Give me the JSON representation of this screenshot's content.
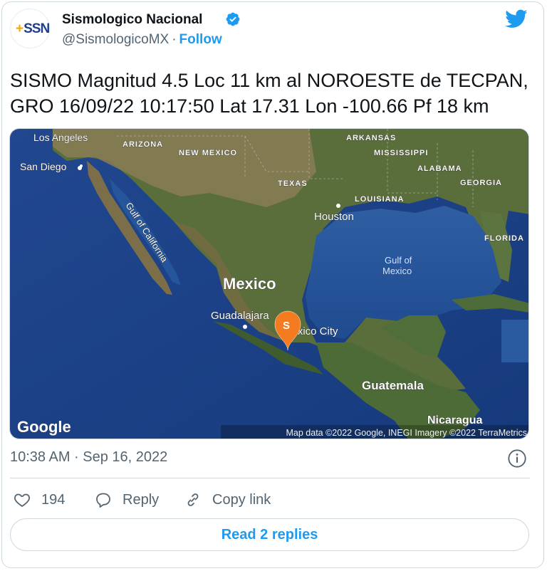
{
  "account": {
    "avatar_text": "SSN",
    "display_name": "Sismologico Nacional",
    "handle": "@SismologicoMX",
    "separator": "·",
    "follow_label": "Follow"
  },
  "tweet": {
    "text": "SISMO Magnitud 4.5 Loc  11 km al NOROESTE de TECPAN,\nGRO 16/09/22 10:17:50 Lat 17.31 Lon -100.66 Pf 18 km",
    "timestamp": "10:38 AM · Sep 16, 2022"
  },
  "map": {
    "labels": {
      "los_angeles": "Los Angeles",
      "arizona": "ARIZONA",
      "new_mexico": "NEW MEXICO",
      "arkansas": "ARKANSAS",
      "mississippi": "MISSISSIPPI",
      "alabama": "ALABAMA",
      "georgia": "GEORGIA",
      "san_diego": "San Diego",
      "texas": "TEXAS",
      "louisiana": "LOUISIANA",
      "houston": "Houston",
      "florida": "FLORIDA",
      "gulf_of_california": "Gulf of California",
      "gulf_of_mexico_1": "Gulf of",
      "gulf_of_mexico_2": "Mexico",
      "mexico": "Mexico",
      "guadalajara": "Guadalajara",
      "mexico_city": "Mexico City",
      "guatemala": "Guatemala",
      "nicaragua": "Nicaragua"
    },
    "marker_letter": "S",
    "logo": "Google",
    "attribution": "Map data ©2022 Google, INEGI Imagery ©2022 TerraMetrics",
    "colors": {
      "ocean": "#1b3f86",
      "land": "#4a6a3a",
      "marker": "#f47b20"
    }
  },
  "actions": {
    "likes_count": "194",
    "reply_label": "Reply",
    "copy_link_label": "Copy link"
  },
  "read_replies_label": "Read 2 replies",
  "colors": {
    "accent": "#1d9bf0",
    "muted": "#536471",
    "border": "#cfd9de"
  }
}
